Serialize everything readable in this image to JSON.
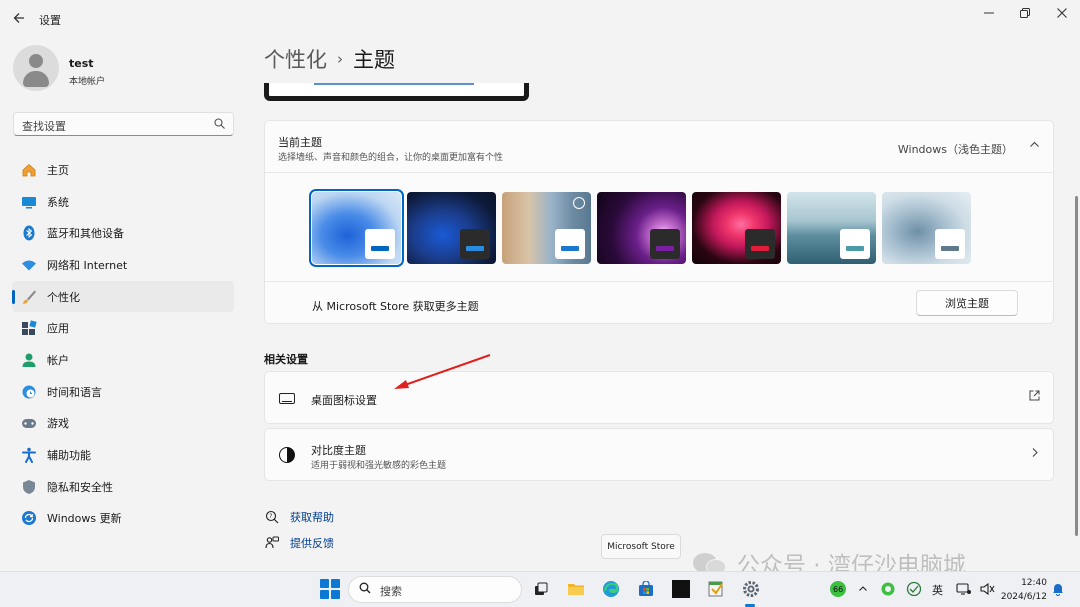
{
  "window": {
    "title": "设置",
    "back_icon": "arrow-left-icon",
    "controls": [
      "minimize-icon",
      "restore-icon",
      "close-icon"
    ]
  },
  "profile": {
    "name": "test",
    "account_type": "本地帐户"
  },
  "search": {
    "placeholder": "查找设置"
  },
  "nav": {
    "items": [
      {
        "label": "主页",
        "icon": "home-icon"
      },
      {
        "label": "系统",
        "icon": "system-icon"
      },
      {
        "label": "蓝牙和其他设备",
        "icon": "bluetooth-icon"
      },
      {
        "label": "网络和 Internet",
        "icon": "wifi-icon"
      },
      {
        "label": "个性化",
        "icon": "brush-icon",
        "active": true
      },
      {
        "label": "应用",
        "icon": "apps-icon"
      },
      {
        "label": "帐户",
        "icon": "account-icon"
      },
      {
        "label": "时间和语言",
        "icon": "clock-globe-icon"
      },
      {
        "label": "游戏",
        "icon": "gamepad-icon"
      },
      {
        "label": "辅助功能",
        "icon": "accessibility-icon"
      },
      {
        "label": "隐私和安全性",
        "icon": "shield-icon"
      },
      {
        "label": "Windows 更新",
        "icon": "update-icon"
      }
    ]
  },
  "breadcrumb": {
    "parent": "个性化",
    "separator": "›",
    "current": "主题"
  },
  "current_theme": {
    "title": "当前主题",
    "subtitle": "选择墙纸、声音和颜色的组合，让你的桌面更加富有个性",
    "value": "Windows（浅色主题）",
    "themes": [
      {
        "name": "windows-light",
        "selected": true
      },
      {
        "name": "windows-dark"
      },
      {
        "name": "flowers-glow"
      },
      {
        "name": "glow"
      },
      {
        "name": "captured-motion"
      },
      {
        "name": "sunrise"
      },
      {
        "name": "flow"
      }
    ],
    "store_text": "从 Microsoft Store 获取更多主题",
    "browse_button": "浏览主题"
  },
  "related": {
    "section_title": "相关设置",
    "desktop_icons": {
      "title": "桌面图标设置",
      "icon": "monitor-icon",
      "trailing_icon": "external-link-icon"
    },
    "contrast": {
      "title": "对比度主题",
      "subtitle": "适用于弱视和强光敏感的彩色主题",
      "icon": "contrast-icon",
      "trailing_icon": "chevron-right-icon"
    }
  },
  "help": {
    "get_help": "获取帮助",
    "feedback": "提供反馈"
  },
  "tooltip": {
    "text": "Microsoft Store"
  },
  "watermark": {
    "text": "公众号 · 湾仔沙电脑城"
  },
  "taskbar": {
    "search_placeholder": "搜索",
    "input_method": "英",
    "time": "12:40",
    "date": "2024/6/12",
    "badge": "66"
  },
  "colors": {
    "accent": "#0067c0",
    "link": "#003e92",
    "annotation_arrow": "#e0201e"
  }
}
